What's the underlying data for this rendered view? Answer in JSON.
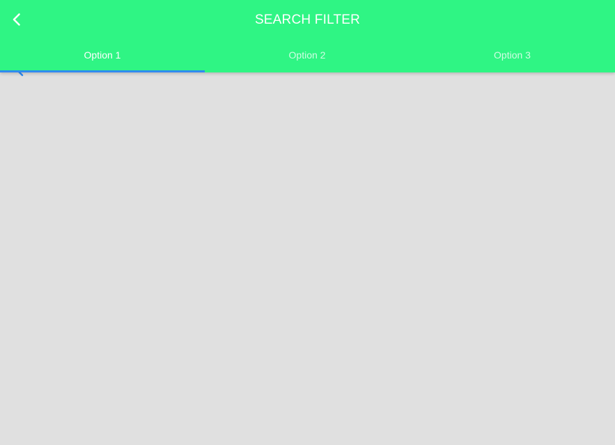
{
  "header": {
    "title": "SEARCH FILTER"
  },
  "tabs": [
    {
      "label": "Option 1",
      "active": true
    },
    {
      "label": "Option 2",
      "active": false
    },
    {
      "label": "Option 3",
      "active": false
    }
  ],
  "colors": {
    "appbar": "#2ff584",
    "indicator": "#2f8bf0",
    "background": "#e0e0e0",
    "text": "#ffffff"
  },
  "icons": {
    "back": "chevron-left-icon",
    "overflow_hint": "chevron-left-icon"
  }
}
